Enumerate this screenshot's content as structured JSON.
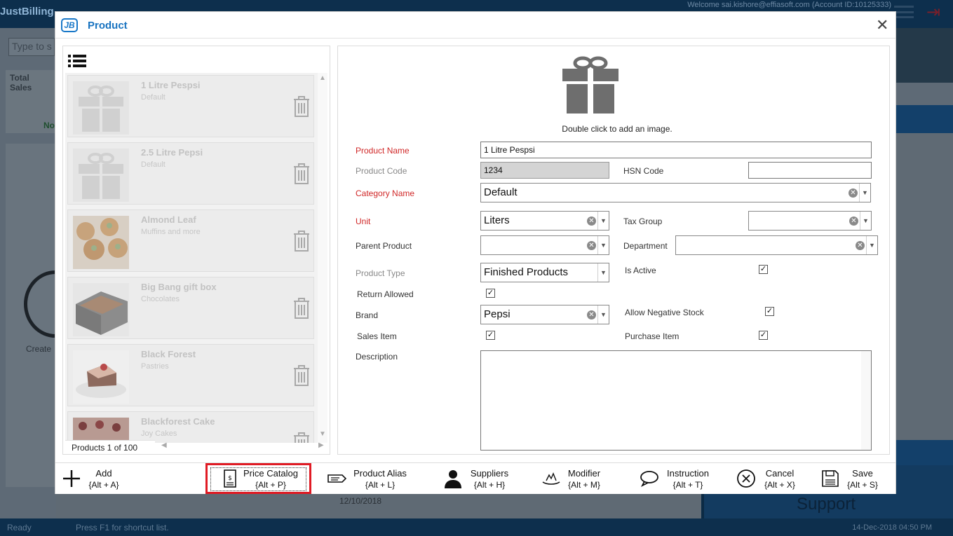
{
  "background": {
    "app_name": "JustBilling",
    "welcome": "Welcome sai.kishore@effiasoft.com (Account ID:10125333)",
    "search_placeholder": "Type to s",
    "total_sales_label": "Total Sales",
    "no_label": "No",
    "create_label": "Create",
    "date_value": "12/10/2018",
    "support_label": "Support",
    "status_ready": "Ready",
    "status_hint": "Press F1 for shortcut list.",
    "clock": "14-Dec-2018 04:50 PM"
  },
  "dialog": {
    "logo": "JB",
    "title": "Product",
    "close_glyph": "✕"
  },
  "product_list": {
    "count_text": "Products 1 of 100",
    "items": [
      {
        "name": "1 Litre Pespsi",
        "category": "Default",
        "thumb": "gift-icon"
      },
      {
        "name": "2.5 Litre Pepsi",
        "category": "Default",
        "thumb": "gift-icon"
      },
      {
        "name": "Almond Leaf",
        "category": "Muffins and more",
        "thumb": "muffin-photo"
      },
      {
        "name": "Big Bang gift box",
        "category": "Chocolates",
        "thumb": "chocolate-box-photo"
      },
      {
        "name": "Black Forest",
        "category": "Pastries",
        "thumb": "cake-photo"
      },
      {
        "name": "Blackforest Cake",
        "category": "Joy Cakes",
        "thumb": "cake-photo"
      }
    ]
  },
  "form": {
    "image_hint": "Double click to add an image.",
    "product_name_label": "Product Name",
    "product_name_value": "1 Litre Pespsi",
    "product_code_label": "Product Code",
    "product_code_value": "1234",
    "hsn_code_label": "HSN Code",
    "hsn_code_value": "",
    "category_label": "Category Name",
    "category_value": "Default",
    "unit_label": "Unit",
    "unit_value": "Liters",
    "tax_group_label": "Tax Group",
    "tax_group_value": "",
    "parent_product_label": "Parent Product",
    "parent_product_value": "",
    "department_label": "Department",
    "department_value": "",
    "product_type_label": "Product Type",
    "product_type_value": "Finished Products",
    "is_active_label": "Is Active",
    "is_active": true,
    "return_allowed_label": "Return Allowed",
    "return_allowed": true,
    "brand_label": "Brand",
    "brand_value": "Pepsi",
    "allow_negative_label": "Allow Negative Stock",
    "allow_negative": true,
    "sales_item_label": "Sales Item",
    "sales_item": true,
    "purchase_item_label": "Purchase Item",
    "purchase_item": true,
    "description_label": "Description",
    "description_value": "",
    "check_glyph": "✓",
    "clear_glyph": "✕",
    "dropdown_glyph": "▼"
  },
  "toolbar": {
    "add": {
      "label": "Add",
      "key": "{Alt + A}"
    },
    "price_catalog": {
      "label": "Price Catalog",
      "key": "{Alt + P}"
    },
    "product_alias": {
      "label": "Product Alias",
      "key": "{Alt + L}"
    },
    "suppliers": {
      "label": "Suppliers",
      "key": "{Alt + H}"
    },
    "modifier": {
      "label": "Modifier",
      "key": "{Alt + M}"
    },
    "instruction": {
      "label": "Instruction",
      "key": "{Alt + T}"
    },
    "cancel": {
      "label": "Cancel",
      "key": "{Alt + X}"
    },
    "save": {
      "label": "Save",
      "key": "{Alt + S}"
    }
  },
  "colors": {
    "accent": "#1873c0",
    "required_label": "#d02828",
    "highlight": "#e01b24"
  }
}
